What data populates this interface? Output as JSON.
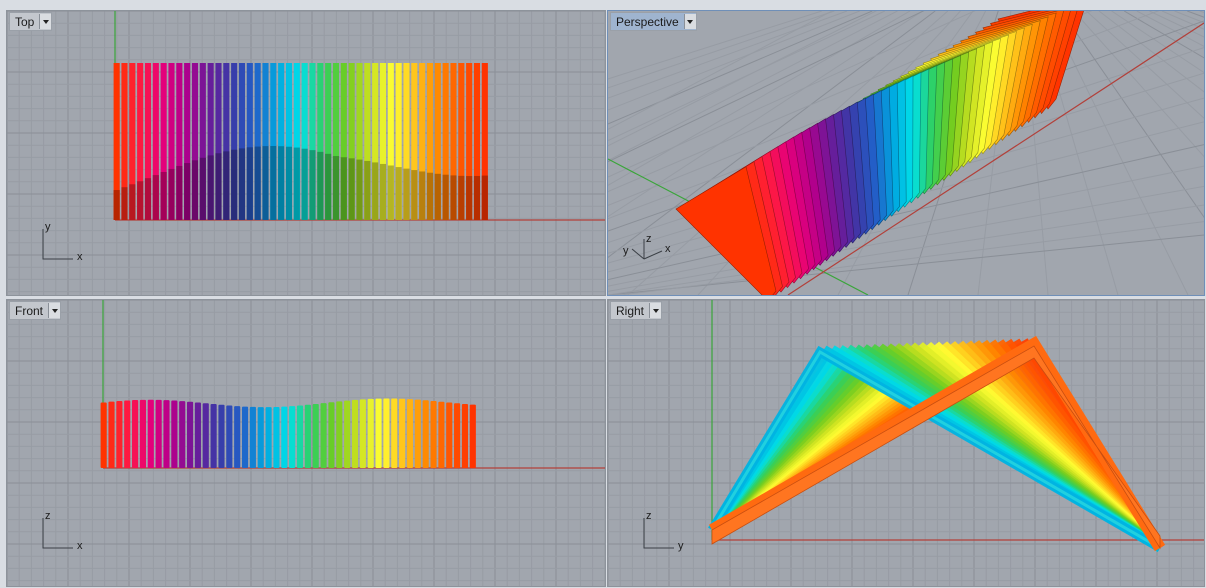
{
  "viewports": {
    "top": {
      "label": "Top",
      "axis_h": "x",
      "axis_v": "y"
    },
    "perspective": {
      "label": "Perspective",
      "axis_x": "x",
      "axis_y": "y",
      "axis_z": "z"
    },
    "front": {
      "label": "Front",
      "axis_h": "x",
      "axis_v": "z"
    },
    "right": {
      "label": "Right",
      "axis_h": "y",
      "axis_v": "z"
    }
  },
  "colors": {
    "background": "#a1a6ae",
    "grid_minor": "#979ca4",
    "grid_major": "#8a8f97",
    "axis_x": "#b2403a",
    "axis_y": "#3aa53a",
    "active_tab": "#9fb4cf",
    "fin_gradient": [
      "#ff3300",
      "#ff1a40",
      "#e6007a",
      "#b0008c",
      "#6a1b9a",
      "#3a3aa8",
      "#2260c8",
      "#00a8e0",
      "#00e0e8",
      "#30d060",
      "#70cc20",
      "#c8e020",
      "#ffff33",
      "#ffc21a",
      "#ff8800",
      "#ff5500",
      "#ff3300"
    ]
  }
}
